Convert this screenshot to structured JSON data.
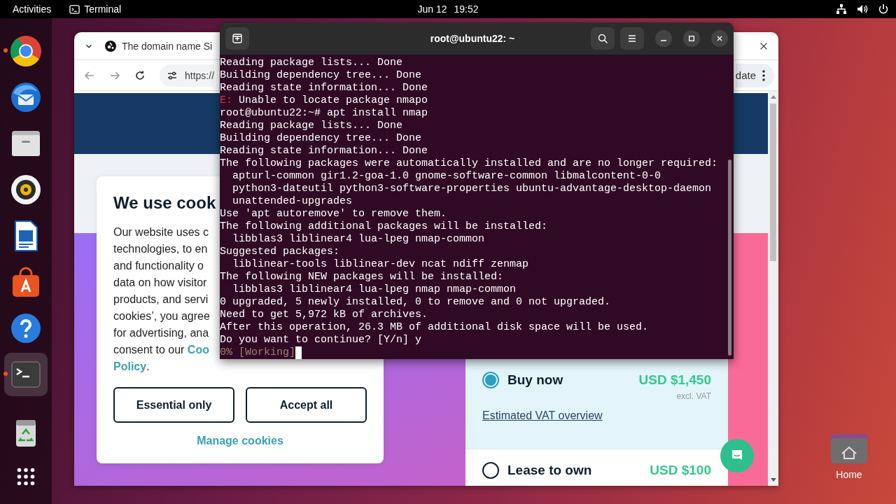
{
  "top_bar": {
    "activities": "Activities",
    "app": "Terminal",
    "date": "Jun 12",
    "time": "19:52"
  },
  "dock": [
    {
      "kind": "browser",
      "running": true,
      "selected": false
    },
    {
      "kind": "mail",
      "running": false,
      "selected": false
    },
    {
      "kind": "files",
      "running": false,
      "selected": false
    },
    {
      "kind": "music",
      "running": false,
      "selected": false
    },
    {
      "kind": "writer",
      "running": false,
      "selected": false
    },
    {
      "kind": "store",
      "running": false,
      "selected": false
    },
    {
      "kind": "help",
      "running": false,
      "selected": false
    },
    {
      "kind": "terminal",
      "running": true,
      "selected": true
    },
    {
      "kind": "trash",
      "running": false,
      "selected": false
    },
    {
      "kind": "apps",
      "running": false,
      "selected": false
    }
  ],
  "browser": {
    "tab_title": "The domain name Si",
    "url": "https://",
    "toolbar_button": "date",
    "cookie_banner": {
      "title": "We use cook",
      "lines": [
        [
          {
            "kind": "plain",
            "text": "Our website uses c"
          }
        ],
        [
          {
            "kind": "plain",
            "text": "technologies, to en"
          }
        ],
        [
          {
            "kind": "plain",
            "text": "and functionality o"
          }
        ],
        [
          {
            "kind": "plain",
            "text": "data on how visitor"
          }
        ],
        [
          {
            "kind": "plain",
            "text": "products, and servi"
          }
        ],
        [
          {
            "kind": "plain",
            "text": "cookies’, you agree"
          }
        ],
        [
          {
            "kind": "plain",
            "text": "for advertising, ana"
          }
        ],
        [
          {
            "kind": "plain",
            "text": "consent to our "
          },
          {
            "kind": "link",
            "text": "Coo"
          }
        ],
        [
          {
            "kind": "link",
            "text": "Policy"
          },
          {
            "kind": "plain",
            "text": "."
          }
        ]
      ],
      "buttons": [
        "Essential only",
        "Accept all"
      ],
      "manage": "Manage cookies"
    },
    "pricing": [
      {
        "label": "Buy now",
        "price": "USD $1,450",
        "note": "excl. VAT",
        "link": "Estimated VAT overview",
        "selected": true
      },
      {
        "label": "Lease to own",
        "price": "USD $100",
        "selected": false
      }
    ]
  },
  "terminal": {
    "title": "root@ubuntu22: ~",
    "lines": [
      [
        {
          "kind": "plain",
          "text": "Reading package lists... Done"
        }
      ],
      [
        {
          "kind": "plain",
          "text": "Building dependency tree... Done"
        }
      ],
      [
        {
          "kind": "plain",
          "text": "Reading state information... Done"
        }
      ],
      [
        {
          "kind": "error",
          "text": "E:"
        },
        {
          "kind": "plain",
          "text": " Unable to locate package nmapo"
        }
      ],
      [
        {
          "kind": "plain",
          "text": "root@ubuntu22:~# apt install nmap"
        }
      ],
      [
        {
          "kind": "plain",
          "text": "Reading package lists... Done"
        }
      ],
      [
        {
          "kind": "plain",
          "text": "Building dependency tree... Done"
        }
      ],
      [
        {
          "kind": "plain",
          "text": "Reading state information... Done"
        }
      ],
      [
        {
          "kind": "plain",
          "text": "The following packages were automatically installed and are no longer required:"
        }
      ],
      [
        {
          "kind": "plain",
          "text": "  apturl-common gir1.2-goa-1.0 gnome-software-common libmalcontent-0-0"
        }
      ],
      [
        {
          "kind": "plain",
          "text": "  python3-dateutil python3-software-properties ubuntu-advantage-desktop-daemon"
        }
      ],
      [
        {
          "kind": "plain",
          "text": "  unattended-upgrades"
        }
      ],
      [
        {
          "kind": "plain",
          "text": "Use 'apt autoremove' to remove them."
        }
      ],
      [
        {
          "kind": "plain",
          "text": "The following additional packages will be installed:"
        }
      ],
      [
        {
          "kind": "plain",
          "text": "  libblas3 liblinear4 lua-lpeg nmap-common"
        }
      ],
      [
        {
          "kind": "plain",
          "text": "Suggested packages:"
        }
      ],
      [
        {
          "kind": "plain",
          "text": "  liblinear-tools liblinear-dev ncat ndiff zenmap"
        }
      ],
      [
        {
          "kind": "plain",
          "text": "The following NEW packages will be installed:"
        }
      ],
      [
        {
          "kind": "plain",
          "text": "  libblas3 liblinear4 lua-lpeg nmap nmap-common"
        }
      ],
      [
        {
          "kind": "plain",
          "text": "0 upgraded, 5 newly installed, 0 to remove and 0 not upgraded."
        }
      ],
      [
        {
          "kind": "plain",
          "text": "Need to get 5,972 kB of archives."
        }
      ],
      [
        {
          "kind": "plain",
          "text": "After this operation, 26.3 MB of additional disk space will be used."
        }
      ],
      [
        {
          "kind": "plain",
          "text": "Do you want to continue? [Y/n] y"
        }
      ],
      [
        {
          "kind": "dim",
          "text": "0% [Working]"
        }
      ]
    ]
  },
  "desktop_icons": [
    {
      "label": "Home"
    }
  ]
}
